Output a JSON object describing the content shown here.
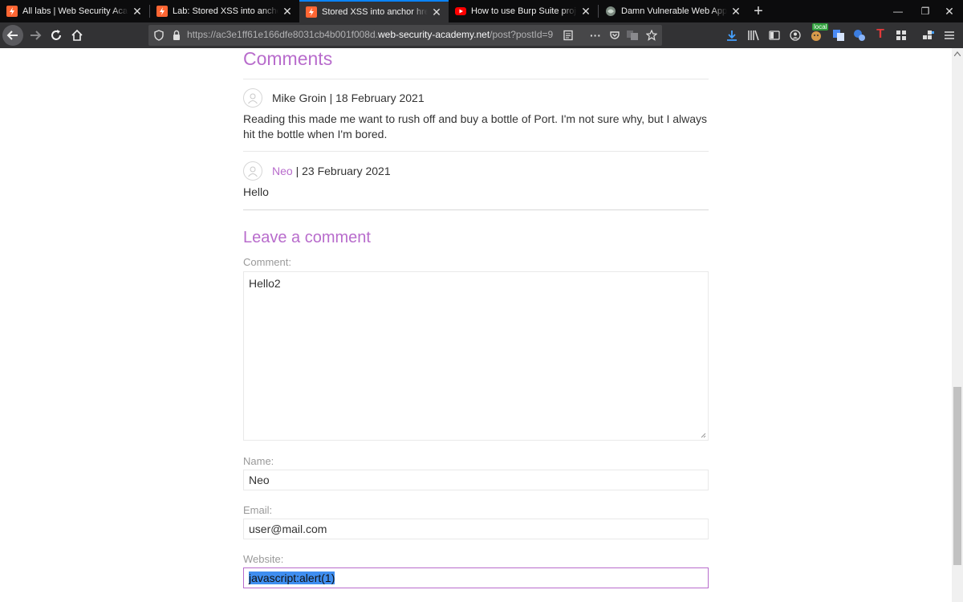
{
  "browser": {
    "tabs": [
      {
        "title": "All labs | Web Security Academy",
        "icon": "portswigger-favicon"
      },
      {
        "title": "Lab: Stored XSS into anchor href attribute",
        "icon": "portswigger-favicon"
      },
      {
        "title": "Stored XSS into anchor href attribute",
        "icon": "portswigger-favicon",
        "active": true
      },
      {
        "title": "How to use Burp Suite projects",
        "icon": "youtube-favicon"
      },
      {
        "title": "Damn Vulnerable Web App (DVWA)",
        "icon": "dvwa-favicon"
      }
    ],
    "url_scheme": "https://ac3e1ff61e166dfe8031cb4b001f008d.",
    "url_host": "web-security-academy.net",
    "url_path": "/post?postId=9",
    "extension_badge": "local"
  },
  "page": {
    "comments_heading": "Comments",
    "comments": [
      {
        "author": "Mike Groin",
        "date": "| 18 February 2021",
        "text": "Reading this made me want to rush off and buy a bottle of Port. I'm not sure why, but I always hit the bottle when I'm bored."
      },
      {
        "author": "Neo",
        "date": "| 23 February 2021",
        "text": "Hello"
      }
    ],
    "leave_heading": "Leave a comment",
    "form": {
      "comment_label": "Comment:",
      "comment_value": "Hello2",
      "name_label": "Name:",
      "name_value": "Neo",
      "email_label": "Email:",
      "email_value": "user@mail.com",
      "website_label": "Website:",
      "website_value": "javascript:alert(1)"
    }
  },
  "colors": {
    "accent": "#b86ccc",
    "tab_indicator": "#0a84ff",
    "selection": "#3f8ef0"
  }
}
